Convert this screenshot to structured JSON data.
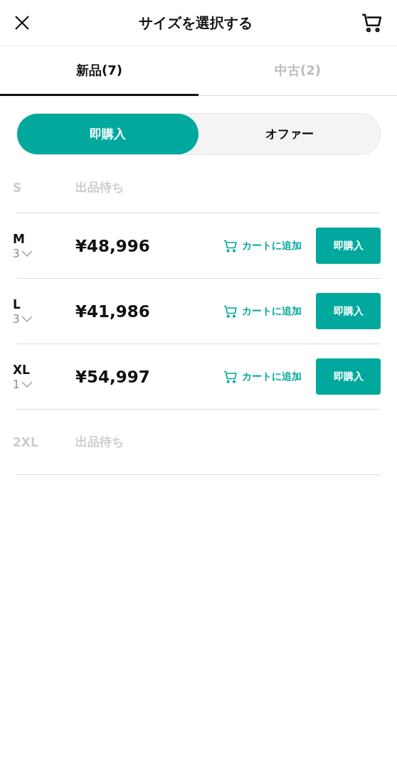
{
  "header": {
    "title": "サイズを選択する"
  },
  "tabs": [
    {
      "label": "新品(7)",
      "selected": true
    },
    {
      "label": "中古(2)",
      "selected": false
    }
  ],
  "segments": [
    {
      "label": "即購入",
      "selected": true
    },
    {
      "label": "オファー",
      "selected": false
    }
  ],
  "rows": [
    {
      "kind": "unavailable",
      "size": "S",
      "status": "出品待ち"
    },
    {
      "kind": "available",
      "size": "M",
      "quantity": "3",
      "price": "¥48,996",
      "cart": "カートに追加",
      "buy": "即購入"
    },
    {
      "kind": "available",
      "size": "L",
      "quantity": "3",
      "price": "¥41,986",
      "cart": "カートに追加",
      "buy": "即購入"
    },
    {
      "kind": "available",
      "size": "XL",
      "quantity": "1",
      "price": "¥54,997",
      "cart": "カートに追加",
      "buy": "即購入"
    },
    {
      "kind": "unavailable",
      "size": "2XL",
      "status": "出品待ち"
    }
  ]
}
